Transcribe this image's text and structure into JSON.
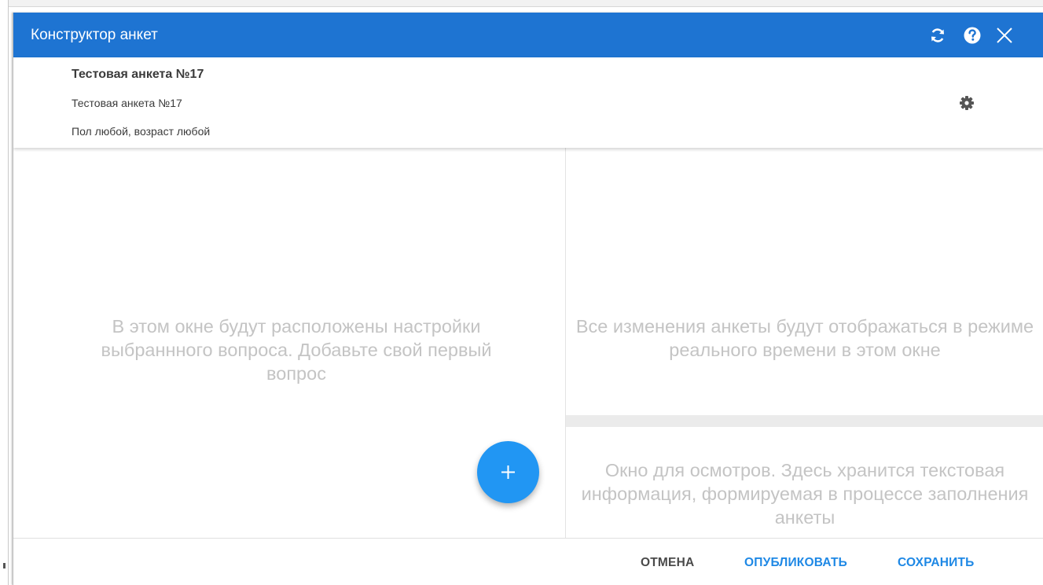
{
  "window": {
    "title": "Конструктор анкет"
  },
  "form": {
    "name": "Тестовая анкета №17",
    "description": "Тестовая анкета №17",
    "filter": "Пол любой, возраст любой"
  },
  "panes": {
    "question_settings_placeholder": "В этом окне будут расположены настройки выбраннного вопроса. Добавьте свой первый вопрос",
    "preview_placeholder": "Все изменения анкеты будут отображаться в режиме реального времени в этом окне",
    "exam_placeholder": "Окно для осмотров. Здесь хранится текстовая информация, формируемая в процессе заполнения анкеты"
  },
  "footer": {
    "cancel_label": "ОТМЕНА",
    "publish_label": "ОПУБЛИКОВАТЬ",
    "save_label": "СОХРАНИТЬ"
  },
  "icons": {
    "refresh": "refresh-icon",
    "help": "help-icon",
    "close": "close-icon",
    "settings": "gear-icon",
    "add": "plus-icon"
  },
  "colors": {
    "titlebar": "#1e74d2",
    "fab": "#2196f3",
    "primary_action": "#1e88e5",
    "placeholder_text": "#c4c4c4"
  }
}
